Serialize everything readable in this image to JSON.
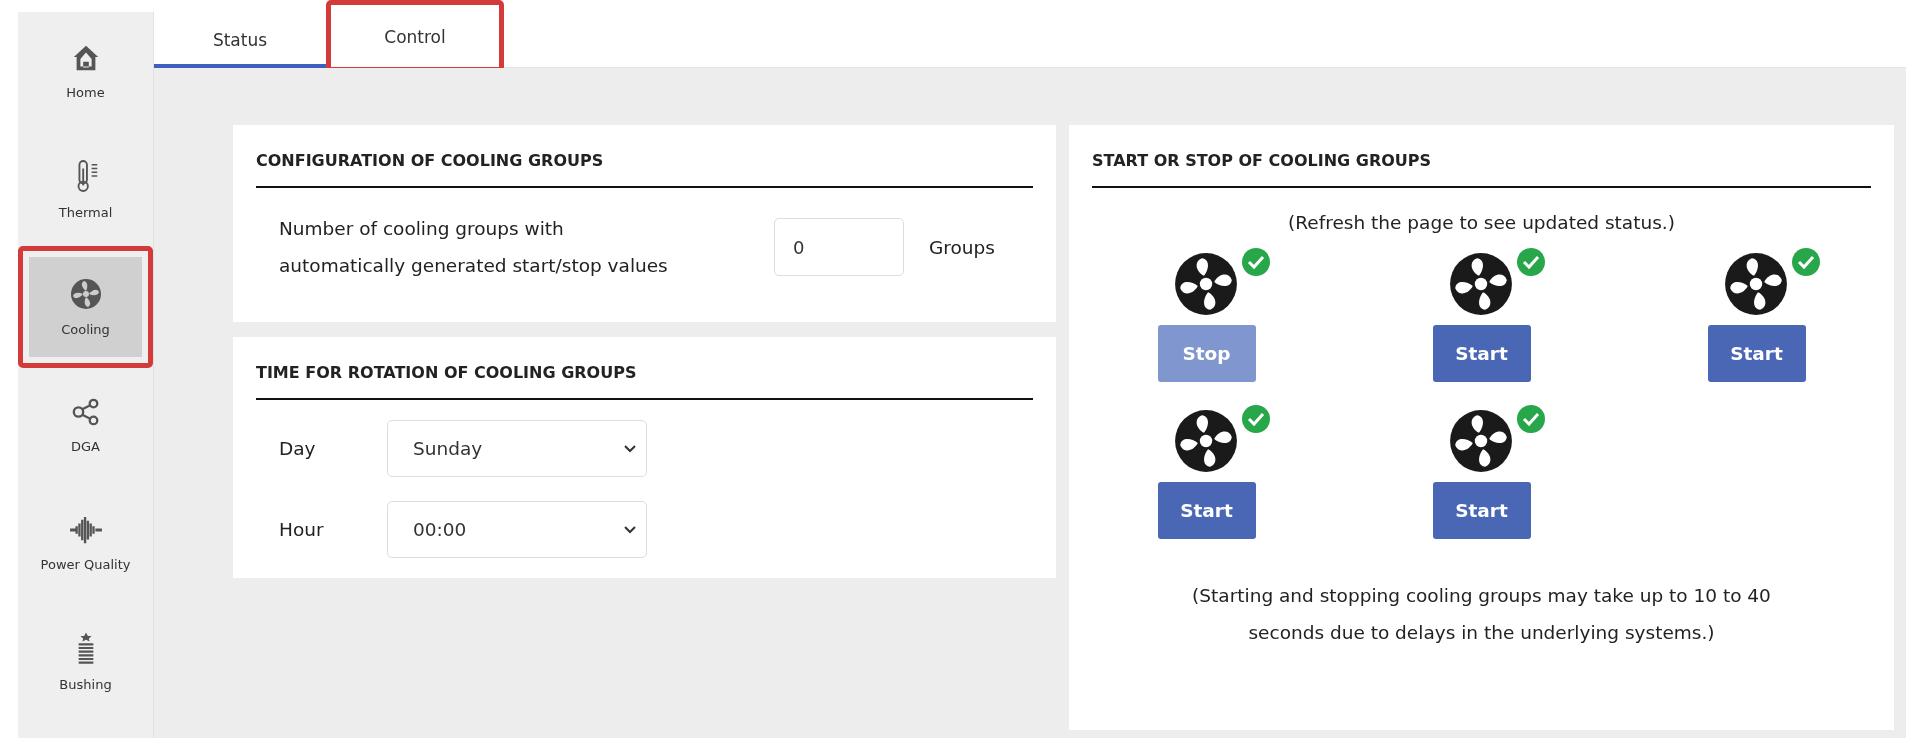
{
  "sidebar": {
    "items": [
      {
        "label": "Home",
        "kind": "home",
        "selected": false,
        "highlighted": false
      },
      {
        "label": "Thermal",
        "kind": "thermal",
        "selected": false,
        "highlighted": false
      },
      {
        "label": "Cooling",
        "kind": "fan",
        "selected": true,
        "highlighted": true
      },
      {
        "label": "DGA",
        "kind": "dga",
        "selected": false,
        "highlighted": false
      },
      {
        "label": "Power Quality",
        "kind": "wave",
        "selected": false,
        "highlighted": false
      },
      {
        "label": "Bushing",
        "kind": "bushing",
        "selected": false,
        "highlighted": false
      }
    ]
  },
  "tabs": [
    {
      "label": "Status",
      "selected": true,
      "highlighted": false
    },
    {
      "label": "Control",
      "selected": false,
      "highlighted": true
    }
  ],
  "configuration": {
    "title": "CONFIGURATION OF COOLING GROUPS",
    "label": "Number of cooling groups with automatically generated start/stop values",
    "value": "0",
    "unit": "Groups"
  },
  "rotation": {
    "title": "TIME FOR ROTATION OF COOLING GROUPS",
    "fields": [
      {
        "label": "Day",
        "value": "Sunday"
      },
      {
        "label": "Hour",
        "value": "00:00"
      }
    ]
  },
  "start_stop": {
    "title": "START OR STOP OF COOLING GROUPS",
    "note": "(Refresh the page to see updated status.)",
    "groups": [
      {
        "ok": true,
        "button": "Stop",
        "disabled": true
      },
      {
        "ok": true,
        "button": "Start",
        "disabled": false
      },
      {
        "ok": true,
        "button": "Start",
        "disabled": false
      },
      {
        "ok": true,
        "button": "Start",
        "disabled": false
      },
      {
        "ok": true,
        "button": "Start",
        "disabled": false
      }
    ],
    "footnote": "(Starting and stopping cooling groups may take up to 10 to 40 seconds due to delays in the underlying systems.)"
  }
}
